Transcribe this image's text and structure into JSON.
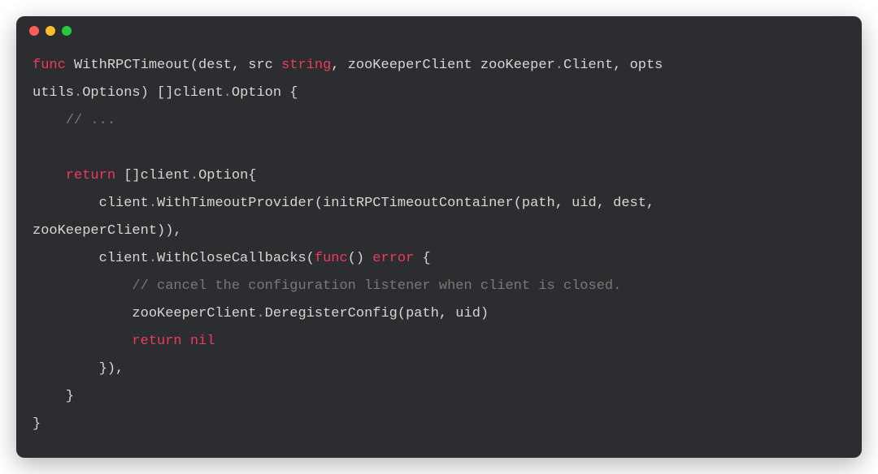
{
  "colors": {
    "background": "#2b2d30",
    "text": "#d8d6cf",
    "keyword": "#ef3a5d",
    "muted_punct": "#a090c4",
    "comment": "#7a7a72",
    "dot_red": "#ff5f56",
    "dot_yellow": "#ffbd2e",
    "dot_green": "#27c93f"
  },
  "tokens": {
    "func": "func",
    "fn_name": " WithRPCTimeout",
    "paren_open": "(",
    "params1": "dest, src ",
    "type_string": "string",
    "params2": ", zooKeeperClient zooKeeper",
    "dot": ".",
    "client_type": "Client",
    "params3": ", opts",
    "line2a": "utils",
    "line2b": "Options",
    "line2c": ") []client",
    "line2d": "Option {",
    "line3_comment": "    // ...",
    "line4": "",
    "line5_return": "    return",
    "line5_rest": " []client",
    "line5_opt": "Option{",
    "line6a": "        client",
    "line6b": "WithTimeoutProvider(initRPCTimeoutContainer(path, uid, dest,",
    "line7": "zooKeeperClient)),",
    "line8a": "        client",
    "line8b": "WithCloseCallbacks(",
    "line8_func": "func",
    "line8c": "() ",
    "line8_error": "error",
    "line8d": " {",
    "line9_comment": "            // cancel the configuration listener when client is closed.",
    "line10a": "            zooKeeperClient",
    "line10b": "DeregisterConfig(path, uid)",
    "line11_return": "            return",
    "line11_sp": " ",
    "line11_nil": "nil",
    "line12": "        }),",
    "line13": "    }",
    "line14": "}"
  }
}
